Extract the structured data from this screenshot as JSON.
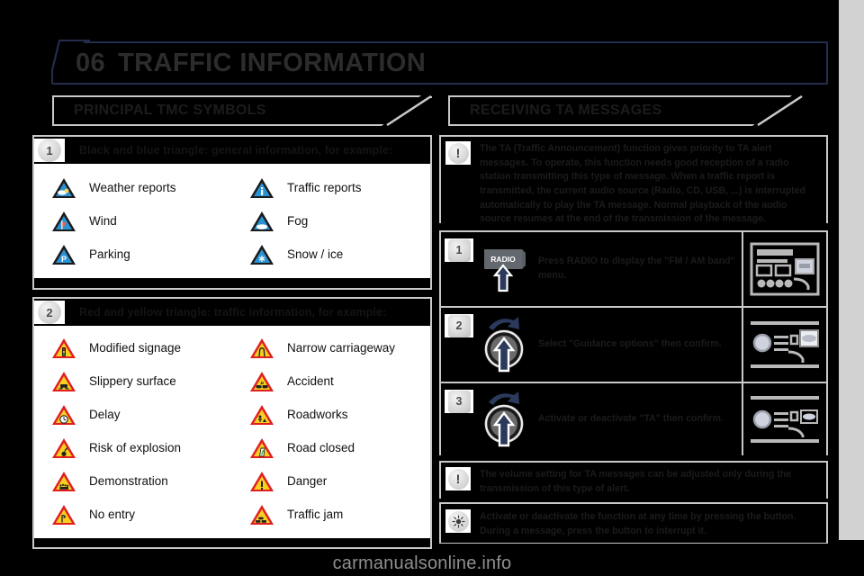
{
  "header": {
    "chapter_number": "06",
    "title": "TRAFFIC INFORMATION",
    "accent_color": "#232d4d"
  },
  "left_column": {
    "section_title": "PRINCIPAL TMC SYMBOLS",
    "groups": [
      {
        "badge": "1",
        "heading": "Black and blue triangle: general information, for example:",
        "symbol_style": "blue-triangle",
        "symbols": [
          {
            "label": "Weather reports",
            "icon": "weather-triangle-icon"
          },
          {
            "label": "Traffic reports",
            "icon": "info-triangle-icon"
          },
          {
            "label": "Wind",
            "icon": "wind-triangle-icon"
          },
          {
            "label": "Fog",
            "icon": "fog-triangle-icon"
          },
          {
            "label": "Parking",
            "icon": "parking-triangle-icon"
          },
          {
            "label": "Snow / ice",
            "icon": "snow-ice-triangle-icon"
          }
        ]
      },
      {
        "badge": "2",
        "heading": "Red and yellow triangle: traffic information, for example:",
        "symbol_style": "yellow-triangle",
        "symbols": [
          {
            "label": "Modified signage",
            "icon": "traffic-light-triangle-icon"
          },
          {
            "label": "Narrow carriageway",
            "icon": "narrow-road-triangle-icon"
          },
          {
            "label": "Slippery surface",
            "icon": "slippery-triangle-icon"
          },
          {
            "label": "Accident",
            "icon": "accident-triangle-icon"
          },
          {
            "label": "Delay",
            "icon": "clock-triangle-icon"
          },
          {
            "label": "Roadworks",
            "icon": "roadworks-triangle-icon"
          },
          {
            "label": "Risk of explosion",
            "icon": "explosion-triangle-icon"
          },
          {
            "label": "Road closed",
            "icon": "road-closed-triangle-icon"
          },
          {
            "label": "Demonstration",
            "icon": "demonstration-triangle-icon"
          },
          {
            "label": "Danger",
            "icon": "danger-triangle-icon"
          },
          {
            "label": "No entry",
            "icon": "no-entry-triangle-icon"
          },
          {
            "label": "Traffic jam",
            "icon": "traffic-jam-triangle-icon"
          }
        ]
      }
    ]
  },
  "right_column": {
    "section_title": "RECEIVING TA MESSAGES",
    "intro_note": {
      "icon": "warning-exclamation-icon",
      "text": "The TA (Traffic Announcement) function gives priority to TA alert messages. To operate, this function needs good reception of a radio station transmitting this type of message. When a traffic report is transmitted, the current audio source (Radio, CD, USB, ...) is interrupted automatically to play the TA message. Normal playback of the audio source resumes at the end of the transmission of the message."
    },
    "steps": [
      {
        "number": "1",
        "control": "radio-button-control",
        "control_label": "RADIO",
        "text": "Press RADIO to display the \"FM / AM band\" menu.",
        "thumb": "screen-thumbnail-1"
      },
      {
        "number": "2",
        "control": "rotary-knob-control",
        "control_label": "",
        "text": "Select \"Guidance options\" then confirm.",
        "thumb": "screen-thumbnail-2"
      },
      {
        "number": "3",
        "control": "rotary-knob-control",
        "control_label": "",
        "text": "Activate or deactivate \"TA\" then confirm.",
        "thumb": "screen-thumbnail-3"
      }
    ],
    "footer_notes": [
      {
        "icon": "warning-exclamation-icon",
        "text": "The volume setting for TA messages can be adjusted only during the transmission of this type of alert."
      },
      {
        "icon": "tip-sun-icon",
        "text": "Activate or deactivate the function at any time by pressing the button. During a message, press the button to interrupt it."
      }
    ]
  },
  "watermark": "carmanualsonline.info"
}
